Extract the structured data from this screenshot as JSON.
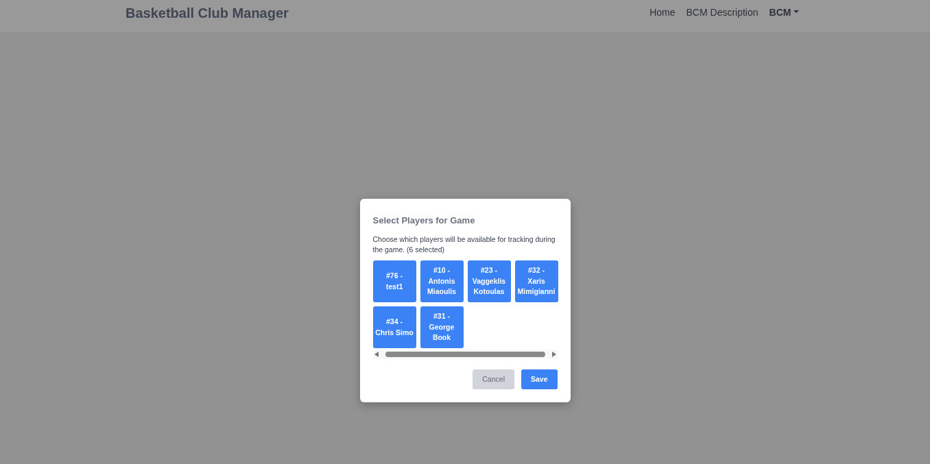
{
  "navbar": {
    "brand": "Basketball Club Manager",
    "links": [
      {
        "label": "Home",
        "kind": "link"
      },
      {
        "label": "BCM Description",
        "kind": "link"
      },
      {
        "label": "BCM",
        "kind": "dropdown"
      }
    ]
  },
  "modal": {
    "title": "Select Players for Game",
    "description": "Choose which players will be available for tracking during the game. (6 selected)",
    "players": [
      {
        "number": "#76 -",
        "name": "test1",
        "selected": true
      },
      {
        "number": "#10 -",
        "name": "Antonis Miaoulis",
        "selected": true
      },
      {
        "number": "#23 -",
        "name": "Vaggeklis Kotoulas",
        "selected": true
      },
      {
        "number": "#32 -",
        "name": "Xaris Mimigianni",
        "selected": true
      },
      {
        "number": "#34 -",
        "name": "Chris Simo",
        "selected": true
      },
      {
        "number": "#31 -",
        "name": "George Book",
        "selected": true
      }
    ],
    "buttons": [
      {
        "label": "Cancel",
        "kind": "secondary",
        "disabled": true
      },
      {
        "label": "Save",
        "kind": "primary",
        "disabled": false
      }
    ]
  }
}
